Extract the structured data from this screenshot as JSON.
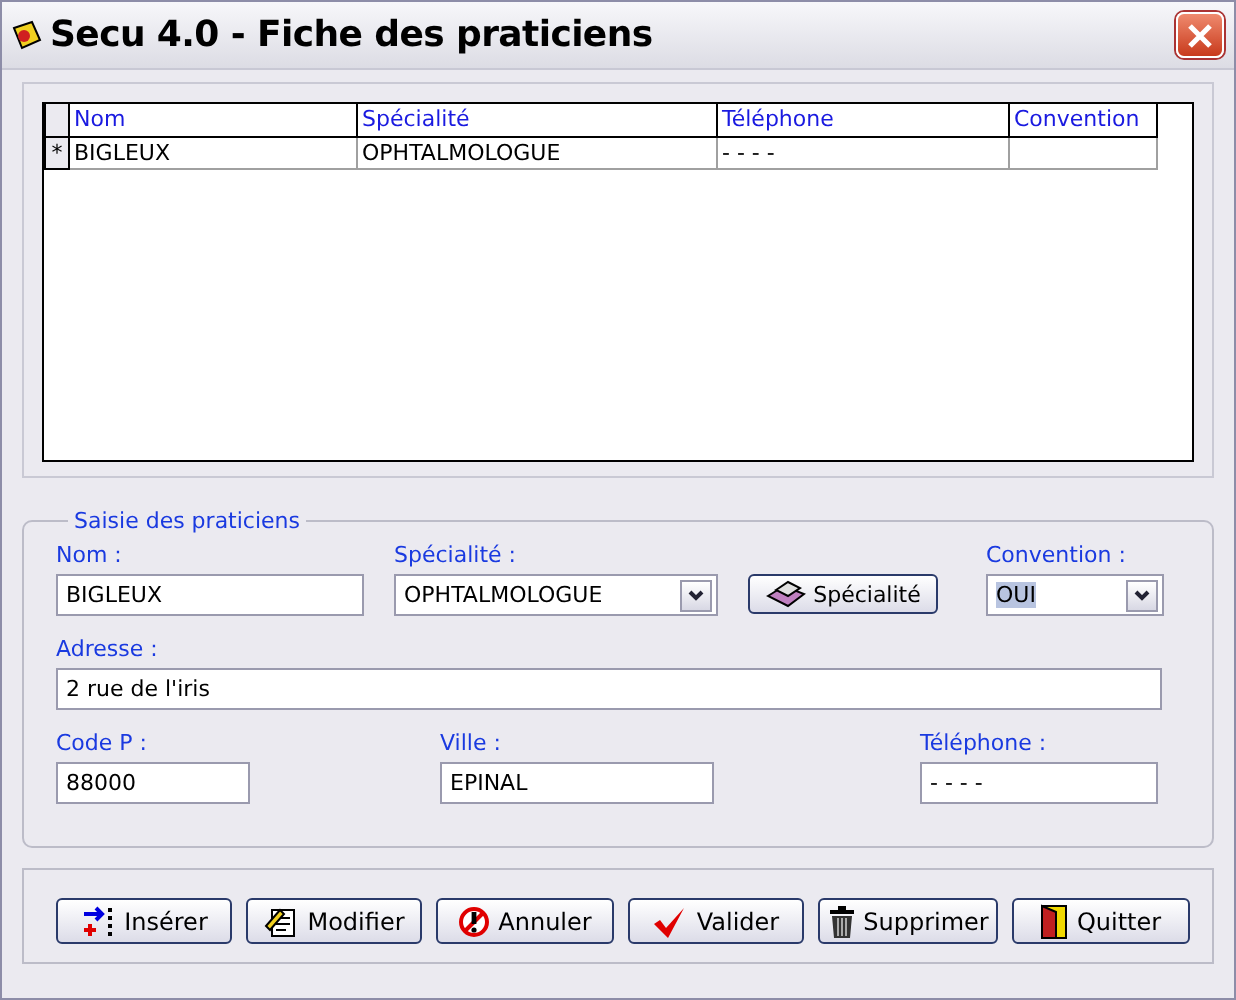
{
  "window": {
    "title": "Secu 4.0 - Fiche des praticiens"
  },
  "grid": {
    "columns": [
      "Nom",
      "Spécialité",
      "Téléphone",
      "Convention"
    ],
    "rows": [
      {
        "marker": "*",
        "cells": [
          "BIGLEUX",
          "OPHTALMOLOGUE",
          "- - - -"
        ]
      }
    ]
  },
  "form": {
    "legend": "Saisie des praticiens",
    "rows": [
      [
        {
          "kind": "text",
          "label": "Nom :",
          "value": "BIGLEUX"
        },
        {
          "kind": "select",
          "label": "Spécialité :",
          "value": "OPHTALMOLOGUE",
          "focused": false
        },
        {
          "kind": "button",
          "text": "Spécialité"
        },
        {
          "kind": "select",
          "label": "Convention :",
          "value": "OUI",
          "focused": true
        }
      ],
      [
        {
          "kind": "text",
          "label": "Adresse :",
          "value": "2 rue de l'iris"
        }
      ],
      [
        {
          "kind": "text",
          "label": "Code P :",
          "value": "88000"
        },
        {
          "kind": "text",
          "label": "Ville :",
          "value": "EPINAL"
        },
        {
          "kind": "text",
          "label": "Téléphone :",
          "value": "- - - -"
        }
      ]
    ]
  },
  "buttons": [
    {
      "text": "Insérer"
    },
    {
      "text": "Modifier"
    },
    {
      "text": "Annuler"
    },
    {
      "text": "Valider"
    },
    {
      "text": "Supprimer"
    },
    {
      "text": "Quitter"
    }
  ]
}
